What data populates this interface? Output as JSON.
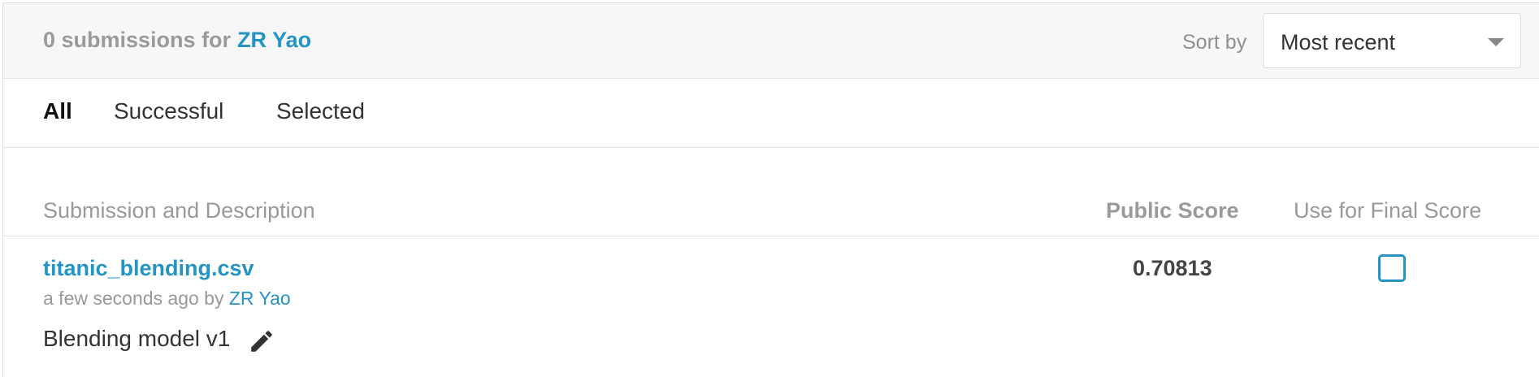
{
  "header": {
    "count_text": "0 submissions for",
    "user_name": "ZR Yao",
    "sort_label": "Sort by",
    "sort_value": "Most recent"
  },
  "tabs": [
    {
      "label": "All",
      "active": true
    },
    {
      "label": "Successful",
      "active": false
    },
    {
      "label": "Selected",
      "active": false
    }
  ],
  "columns": {
    "submission": "Submission and Description",
    "public_score": "Public Score",
    "final_score": "Use for Final Score"
  },
  "submissions": [
    {
      "file_name": "titanic_blending.csv",
      "time": "a few seconds ago by",
      "author": "ZR Yao",
      "description": "Blending model v1",
      "public_score": "0.70813",
      "use_for_final": false
    }
  ],
  "colors": {
    "link": "#2394c4",
    "header_bg": "#f7f7f7",
    "muted_text": "#999999"
  },
  "icons": {
    "edit": "pencil-icon",
    "sort_dropdown": "caret-down-icon"
  }
}
